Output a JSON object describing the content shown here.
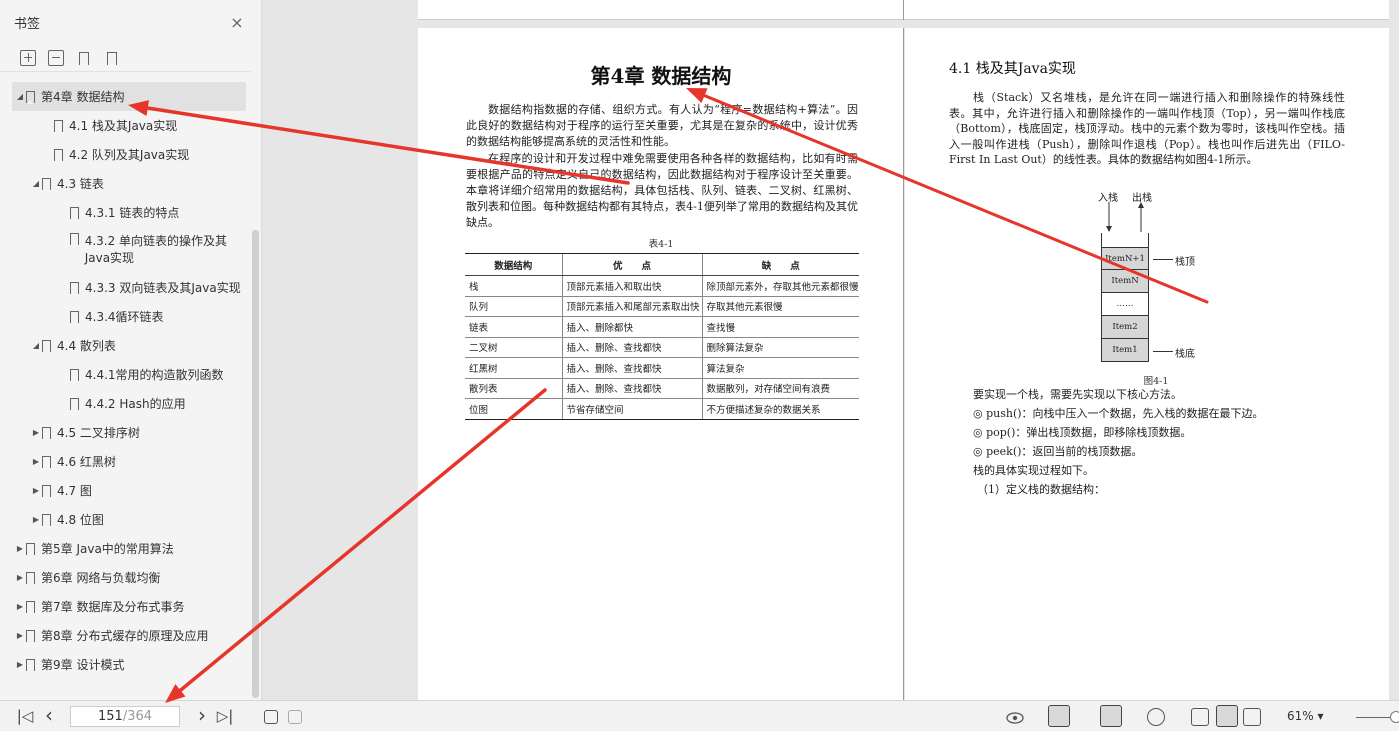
{
  "sidebar": {
    "title": "书签",
    "close_icon": "×",
    "items": [
      {
        "label": "第4章 数据结构",
        "caret": "◢",
        "level": 0
      },
      {
        "label": "4.1 栈及其Java实现",
        "caret": "",
        "level": 1
      },
      {
        "label": "4.2 队列及其Java实现",
        "caret": "",
        "level": 1
      },
      {
        "label": "4.3 链表",
        "caret": "◢",
        "level": 1
      },
      {
        "label": "4.3.1 链表的特点",
        "caret": "",
        "level": 2
      },
      {
        "label": "4.3.2 单向链表的操作及其Java实现",
        "caret": "",
        "level": 2
      },
      {
        "label": "4.3.3 双向链表及其Java实现",
        "caret": "",
        "level": 2
      },
      {
        "label": "4.3.4循环链表",
        "caret": "",
        "level": 2
      },
      {
        "label": "4.4 散列表",
        "caret": "◢",
        "level": 1
      },
      {
        "label": "4.4.1常用的构造散列函数",
        "caret": "",
        "level": 2
      },
      {
        "label": "4.4.2 Hash的应用",
        "caret": "",
        "level": 2
      },
      {
        "label": "4.5 二叉排序树",
        "caret": "▶",
        "level": 1
      },
      {
        "label": "4.6 红黑树",
        "caret": "▶",
        "level": 1
      },
      {
        "label": "4.7 图",
        "caret": "▶",
        "level": 1
      },
      {
        "label": "4.8 位图",
        "caret": "▶",
        "level": 1
      },
      {
        "label": "第5章 Java中的常用算法",
        "caret": "▶",
        "level": 0
      },
      {
        "label": "第6章 网络与负载均衡",
        "caret": "▶",
        "level": 0
      },
      {
        "label": "第7章 数据库及分布式事务",
        "caret": "▶",
        "level": 0
      },
      {
        "label": "第8章 分布式缓存的原理及应用",
        "caret": "▶",
        "level": 0
      },
      {
        "label": "第9章 设计模式",
        "caret": "▶",
        "level": 0
      }
    ]
  },
  "bottombar": {
    "first_icon": "|◁",
    "prev_icon": "‹",
    "current_page": "151",
    "total_pages": "/364",
    "next_icon": "›",
    "last_icon": "▷|",
    "zoom": "61%",
    "zoom_caret": "▾"
  },
  "left_page": {
    "chapter_title": "第4章  数据结构",
    "para1": "数据结构指数据的存储、组织方式。有人认为“程序=数据结构+算法”。因此良好的数据结构对于程序的运行至关重要，尤其是在复杂的系统中，设计优秀的数据结构能够提高系统的灵活性和性能。",
    "para2": "在程序的设计和开发过程中难免需要使用各种各样的数据结构，比如有时需要根据产品的特点定义自己的数据结构，因此数据结构对于程序设计至关重要。本章将详细介绍常用的数据结构，具体包括栈、队列、链表、二叉树、红黑树、散列表和位图。每种数据结构都有其特点，表4-1便列举了常用的数据结构及其优缺点。",
    "table_caption": "表4-1",
    "table_headers": [
      "数据结构",
      "优　　点",
      "缺　　点"
    ],
    "table_rows": [
      [
        "栈",
        "顶部元素插入和取出快",
        "除顶部元素外，存取其他元素都很慢"
      ],
      [
        "队列",
        "顶部元素插入和尾部元素取出快",
        "存取其他元素很慢"
      ],
      [
        "链表",
        "插入、删除都快",
        "查找慢"
      ],
      [
        "二叉树",
        "插入、删除、查找都快",
        "删除算法复杂"
      ],
      [
        "红黑树",
        "插入、删除、查找都快",
        "算法复杂"
      ],
      [
        "散列表",
        "插入、删除、查找都快",
        "数据散列，对存储空间有浪费"
      ],
      [
        "位图",
        "节省存储空间",
        "不方便描述复杂的数据关系"
      ]
    ]
  },
  "right_page": {
    "section_title": "4.1  栈及其Java实现",
    "para1": "栈（Stack）又名堆栈，是允许在同一端进行插入和删除操作的特殊线性表。其中，允许进行插入和删除操作的一端叫作栈顶（Top），另一端叫作栈底（Bottom），栈底固定，栈顶浮动。栈中的元素个数为零时，该栈叫作空栈。插入一般叫作进栈（Push），删除叫作退栈（Pop）。栈也叫作后进先出（FILO-First In Last Out）的线性表。具体的数据结构如图4-1所示。",
    "fig_push": "入栈",
    "fig_pop": "出栈",
    "fig_top": "栈顶",
    "fig_bottom": "栈底",
    "fig_cells": [
      "ItemN+1",
      "ItemN",
      "……",
      "Item2",
      "Item1"
    ],
    "fig_caption": "图4-1",
    "lines": [
      "要实现一个栈，需要先实现以下核心方法。",
      "◎ push()：向栈中压入一个数据，先入栈的数据在最下边。",
      "◎ pop()：弹出栈顶数据，即移除栈顶数据。",
      "◎ peek()：返回当前的栈顶数据。",
      "栈的具体实现过程如下。",
      "（1）定义栈的数据结构："
    ]
  },
  "colors": {
    "annotation_arrow": "#e8352b",
    "sidebar_bg": "#f4f4f4",
    "selected_bg": "#e1e1e1"
  }
}
